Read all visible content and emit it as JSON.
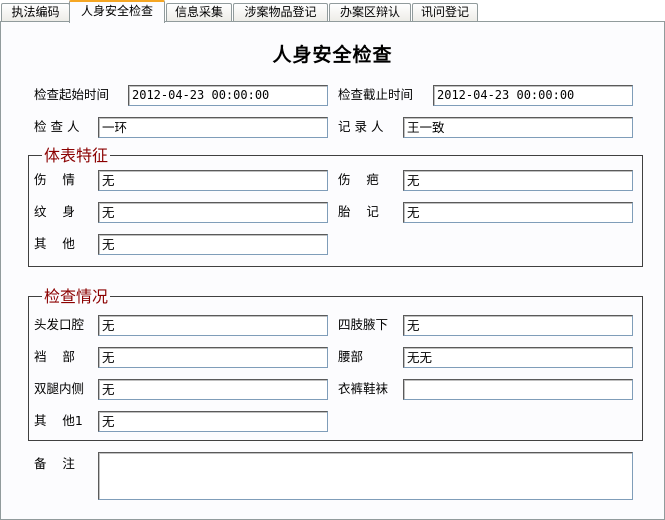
{
  "tabs": [
    "执法编码",
    "人身安全检查",
    "信息采集",
    "涉案物品登记",
    "办案区辩认",
    "讯问登记"
  ],
  "title": "人身安全检查",
  "header": {
    "start_time_label": "检查起始时间",
    "start_time_value": "2012-04-23 00:00:00",
    "end_time_label": "检查截止时间",
    "end_time_value": "2012-04-23 00:00:00",
    "inspector_label": "检 查 人",
    "inspector_value": "一环",
    "recorder_label": "记 录 人",
    "recorder_value": "王一致"
  },
  "body_features": {
    "legend": "体表特征",
    "injury_label": "伤    情",
    "injury_value": "无",
    "scar_label": "伤    疤",
    "scar_value": "无",
    "tattoo_label": "纹    身",
    "tattoo_value": "无",
    "birthmark_label": "胎    记",
    "birthmark_value": "无",
    "other_label": "其    他",
    "other_value": "无"
  },
  "inspection": {
    "legend": "检查情况",
    "head_label": "头发口腔",
    "head_value": "无",
    "limbs_label": "四肢腋下",
    "limbs_value": "无",
    "crotch_label": "裆    部",
    "crotch_value": "无",
    "waist_label": "腰部",
    "waist_value": "无无",
    "thigh_label": "双腿内侧",
    "thigh_value": "无",
    "clothes_label": "衣裤鞋袜",
    "clothes_value": "",
    "other_label": "其    他1",
    "other_value": "无"
  },
  "remarks": {
    "label": "备    注",
    "value": ""
  }
}
